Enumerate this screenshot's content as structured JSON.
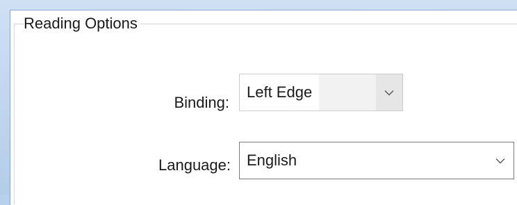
{
  "group": {
    "legend": "Reading Options"
  },
  "fields": {
    "binding": {
      "label": "Binding:",
      "value": "Left Edge"
    },
    "language": {
      "label": "Language:",
      "value": "English"
    }
  },
  "icons": {
    "binding_dropdown": "chevron-down-icon",
    "language_dropdown": "chevron-down-icon"
  }
}
